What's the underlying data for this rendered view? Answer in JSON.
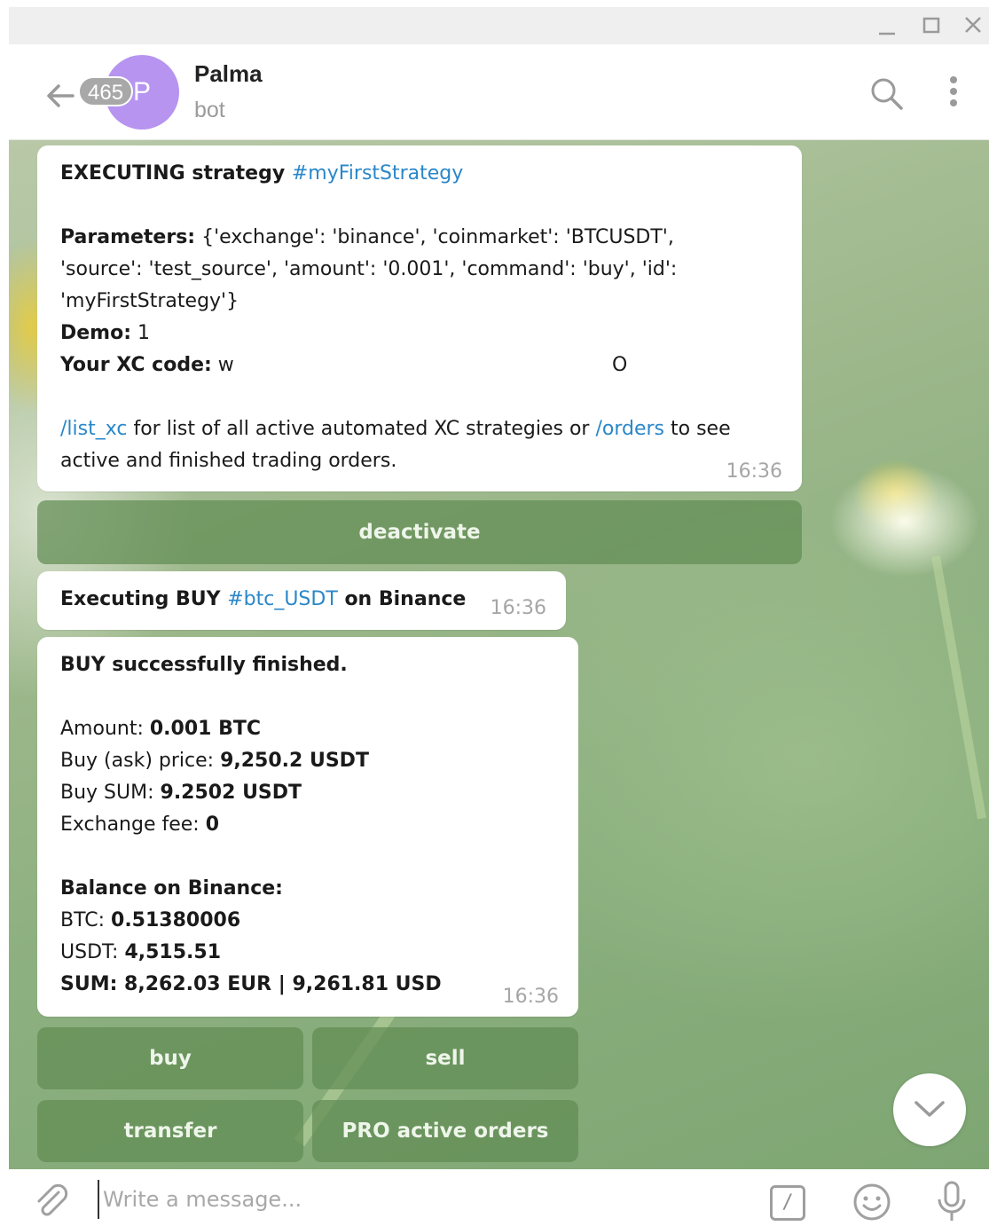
{
  "window": {
    "controls": [
      "minimize-icon",
      "maximize-icon",
      "close-icon"
    ]
  },
  "header": {
    "unread_count": "465",
    "avatar_letter": "P",
    "avatar_color": "#b694f0",
    "chat_name": "Palma",
    "chat_status": "bot",
    "icons": [
      "back-arrow-icon",
      "search-icon",
      "more-vertical-icon"
    ]
  },
  "messages": [
    {
      "title_prefix": "EXECUTING strategy ",
      "title_hashtag": "#myFirstStrategy",
      "params_label": "Parameters:",
      "params_line1": " {'exchange': 'binance', 'coinmarket': 'BTCUSDT',",
      "params_line2": "'source': 'test_source', 'amount': '0.001', 'command': 'buy', 'id':",
      "params_line3": "'myFirstStrategy'}",
      "demo_label": "Demo:",
      "demo_value": " 1",
      "xc_label": "Your XC code:",
      "xc_value": " w",
      "xc_value_end": "O",
      "footer_link1": "/list_xc",
      "footer_text1": " for list of all active automated XC strategies or ",
      "footer_link2": "/orders",
      "footer_text2": " to see",
      "footer_line2": "active and finished trading orders.",
      "time": "16:36"
    },
    {
      "prefix": "Executing BUY ",
      "hashtag": "#btc_USDT",
      "suffix": " on Binance",
      "time": "16:36"
    },
    {
      "heading": "BUY successfully finished.",
      "amount_label": "Amount: ",
      "amount_value": "0.001 BTC",
      "price_label": "Buy (ask) price: ",
      "price_value": "9,250.2 USDT",
      "sum_label": "Buy SUM: ",
      "sum_value": "9.2502 USDT",
      "fee_label": "Exchange fee: ",
      "fee_value": "0",
      "balance_heading": "Balance on Binance:",
      "btc_label": "BTC: ",
      "btc_value": "0.51380006",
      "usdt_label": "USDT: ",
      "usdt_value": "4,515.51",
      "total": "SUM: 8,262.03 EUR | 9,261.81 USD",
      "time": "16:36"
    }
  ],
  "keyboards": {
    "strategy": [
      "deactivate"
    ],
    "trade": [
      "buy",
      "sell",
      "transfer",
      "PRO active orders"
    ]
  },
  "composer": {
    "placeholder": "Write a message...",
    "command_symbol": "/",
    "icons": [
      "attach-icon",
      "emoji-icon",
      "microphone-icon"
    ]
  },
  "colors": {
    "link": "#2a87c9",
    "keyboard_button": "#618c53",
    "badge": "#a8a8a8"
  }
}
